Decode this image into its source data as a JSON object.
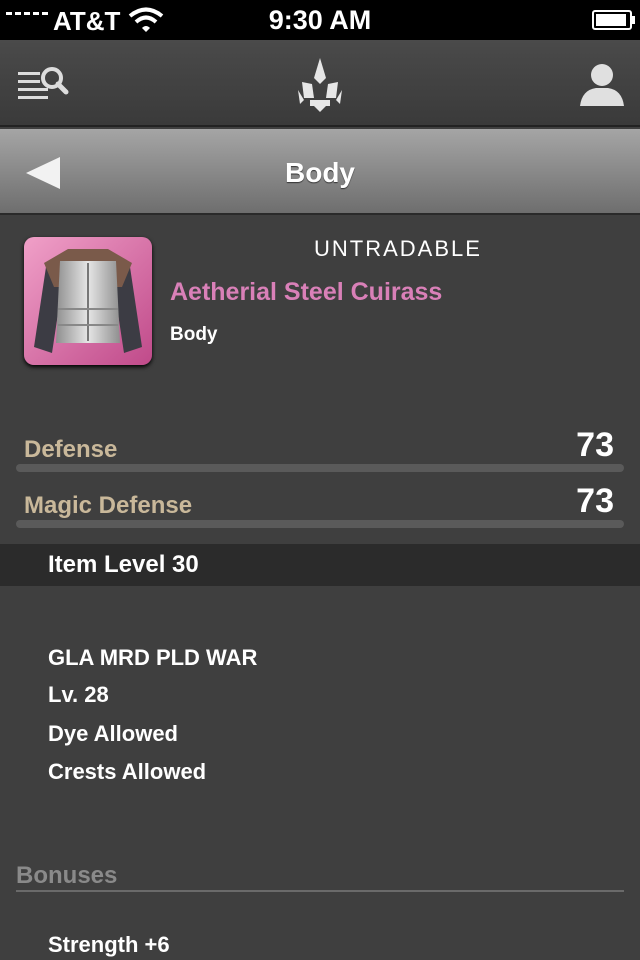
{
  "status_bar": {
    "carrier": "AT&T",
    "time": "9:30 AM"
  },
  "toolbar": {
    "search_icon": "search-list-icon",
    "logo_icon": "fleur-logo-icon",
    "profile_icon": "person-icon"
  },
  "titlebar": {
    "title": "Body",
    "back_icon": "back-arrow-icon"
  },
  "item": {
    "tradability": "UNTRADABLE",
    "name": "Aetherial Steel Cuirass",
    "slot": "Body",
    "name_color": "#d980b8"
  },
  "stats": [
    {
      "label": "Defense",
      "value": "73"
    },
    {
      "label": "Magic Defense",
      "value": "73"
    }
  ],
  "item_level": "Item Level 30",
  "requirements": [
    "GLA MRD PLD WAR",
    "Lv. 28",
    "Dye Allowed",
    "Crests Allowed"
  ],
  "bonuses": {
    "header": "Bonuses",
    "items": [
      "Strength +6"
    ]
  }
}
